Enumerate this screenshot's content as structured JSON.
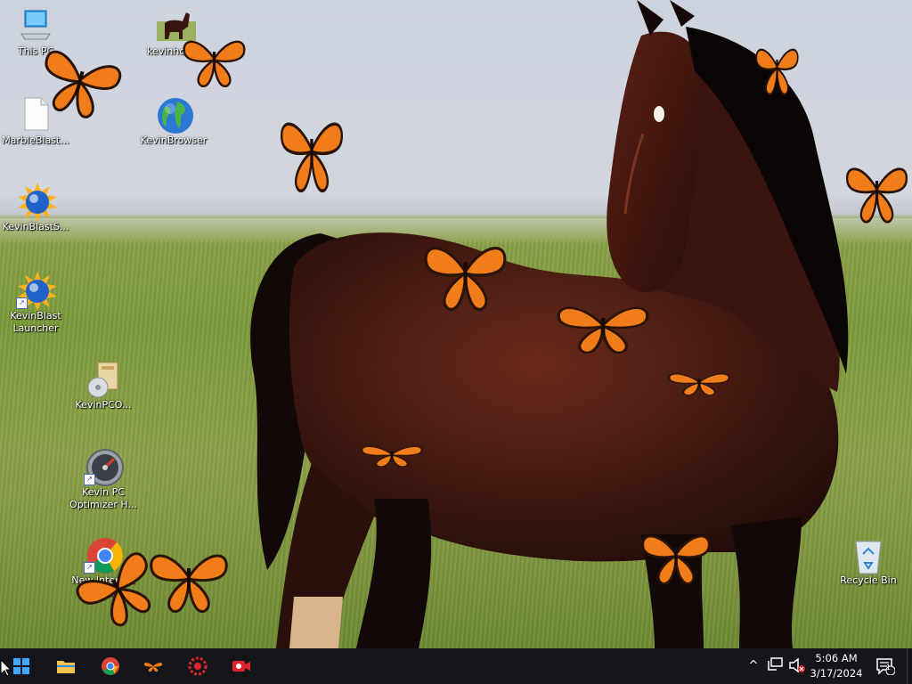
{
  "desktop": {
    "icons": [
      {
        "label": "This PC",
        "icon": "computer-icon"
      },
      {
        "label": "kevinhorse",
        "icon": "horse-image-icon"
      },
      {
        "label": "MarbleBlast...",
        "icon": "blank-file-icon"
      },
      {
        "label": "KevinBrowser",
        "icon": "globe-icon"
      },
      {
        "label": "KevinBlastS...",
        "icon": "sun-globe-icon"
      },
      {
        "label": "KevinBlast Launcher",
        "icon": "sun-globe-icon"
      },
      {
        "label": "KevinPCO...",
        "icon": "installer-icon"
      },
      {
        "label": "Kevin PC Optimizer H...",
        "icon": "speedometer-icon"
      },
      {
        "label": "New Internet Shortcut",
        "icon": "chrome-icon"
      },
      {
        "label": "Recycle Bin",
        "icon": "recycle-bin-icon"
      }
    ]
  },
  "taskbar": {
    "buttons": [
      {
        "name": "start",
        "icon": "windows-logo-icon"
      },
      {
        "name": "file-explorer",
        "icon": "folder-icon"
      },
      {
        "name": "chrome",
        "icon": "chrome-icon"
      },
      {
        "name": "butterfly-app",
        "icon": "butterfly-icon"
      },
      {
        "name": "red-target-app",
        "icon": "red-gear-icon"
      },
      {
        "name": "red-camera-app",
        "icon": "red-camera-icon"
      }
    ],
    "tray": {
      "chevron": "^",
      "time": "5:06 AM",
      "date": "3/17/2024",
      "notification_count": "1"
    }
  },
  "colors": {
    "taskbar": "#14161b",
    "butterfly_orange": "#f07c1a",
    "horse_brown": "#4a1c12"
  }
}
